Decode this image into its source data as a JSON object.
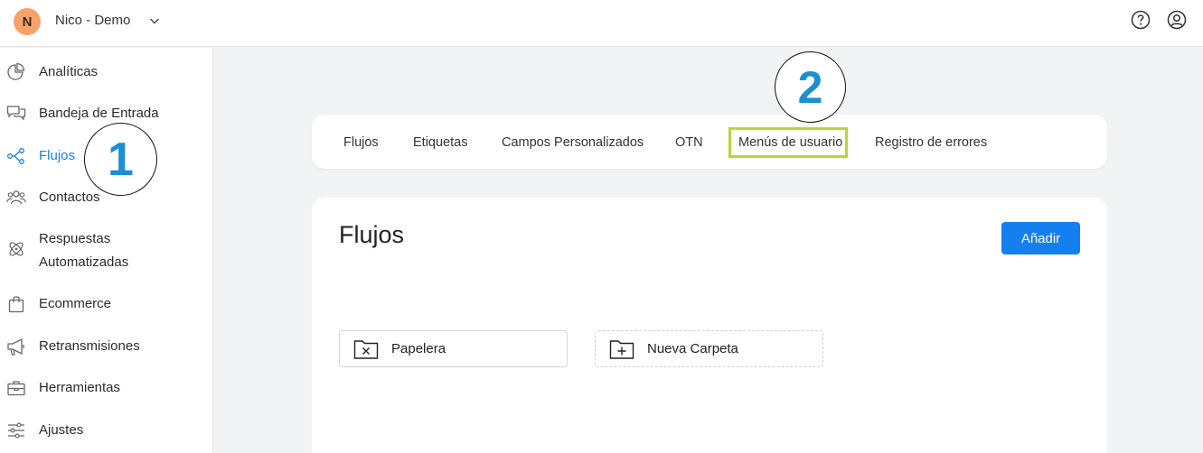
{
  "header": {
    "avatar_letter": "N",
    "workspace_name": "Nico - Demo",
    "icons": [
      "chevron-down-icon",
      "help-icon",
      "user-circle-icon"
    ]
  },
  "sidebar": {
    "active_color": "#1e7fd9",
    "items": [
      {
        "label": "Analíticas",
        "icon": "pie-chart-icon"
      },
      {
        "label": "Bandeja de Entrada",
        "icon": "chat-bubbles-icon"
      },
      {
        "label": "Flujos",
        "icon": "flow-nodes-icon",
        "active": true
      },
      {
        "label": "Contactos",
        "icon": "people-icon"
      },
      {
        "label_line1": "Respuestas",
        "label_line2": "Automatizadas",
        "icon": "atom-icon"
      },
      {
        "label": "Ecommerce",
        "icon": "shopping-bag-icon"
      },
      {
        "label": "Retransmisiones",
        "icon": "megaphone-icon"
      },
      {
        "label": "Herramientas",
        "icon": "toolbox-icon"
      },
      {
        "label": "Ajustes",
        "icon": "sliders-icon"
      }
    ]
  },
  "tabs": [
    {
      "label": "Flujos"
    },
    {
      "label": "Etiquetas"
    },
    {
      "label": "Campos Personalizados"
    },
    {
      "label": "OTN"
    },
    {
      "label": "Menús de usuario",
      "highlighted": true
    },
    {
      "label": "Registro de errores"
    }
  ],
  "highlight_color": "#b9d53a",
  "main": {
    "title": "Flujos",
    "add_button": "Añadir",
    "add_button_color": "#1480f0",
    "folders": [
      {
        "label": "Papelera",
        "icon": "trash-folder-icon"
      },
      {
        "label": "Nueva Carpeta",
        "icon": "new-folder-icon"
      }
    ]
  },
  "callouts": {
    "one": "1",
    "two": "2",
    "color": "#1a8fd3"
  }
}
